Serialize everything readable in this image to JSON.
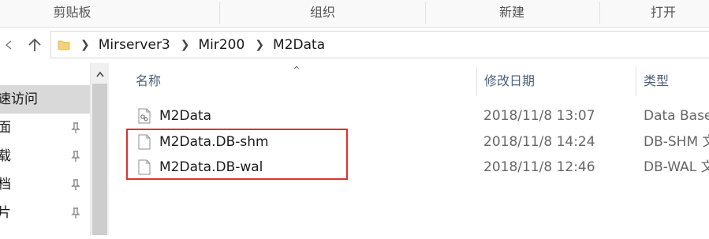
{
  "ribbon": {
    "groups": [
      "剪贴板",
      "组织",
      "新建",
      "打开"
    ]
  },
  "nav": {
    "back_icon": "chevron-left-icon",
    "up_icon": "arrow-up-icon",
    "breadcrumb": [
      "Mirserver3",
      "Mir200",
      "M2Data"
    ]
  },
  "navpane": {
    "items": [
      {
        "label": "速访问",
        "selected": true,
        "pinned": false
      },
      {
        "label": "面",
        "selected": false,
        "pinned": true
      },
      {
        "label": "载",
        "selected": false,
        "pinned": true
      },
      {
        "label": "档",
        "selected": false,
        "pinned": true
      },
      {
        "label": "片",
        "selected": false,
        "pinned": true
      }
    ]
  },
  "columns": {
    "name": "名称",
    "modified": "修改日期",
    "type": "类型",
    "sort_indicator": "^"
  },
  "files": [
    {
      "name": "M2Data",
      "modified": "2018/11/8 13:07",
      "type": "Data Base",
      "icon": "database-file-icon"
    },
    {
      "name": "M2Data.DB-shm",
      "modified": "2018/11/8 14:24",
      "type": "DB-SHM 文",
      "icon": "blank-file-icon"
    },
    {
      "name": "M2Data.DB-wal",
      "modified": "2018/11/8 12:46",
      "type": "DB-WAL 文",
      "icon": "blank-file-icon"
    }
  ],
  "colors": {
    "highlight": "#e03131",
    "selected_nav": "#d9d9d9",
    "header_text": "#4c607a"
  }
}
